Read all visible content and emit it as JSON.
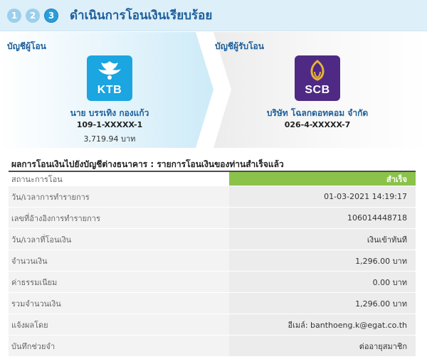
{
  "header": {
    "steps": [
      "1",
      "2",
      "3"
    ],
    "title": "ดำเนินการโอนเงินเรียบร้อย"
  },
  "from_account": {
    "section_label": "บัญชีผู้โอน",
    "bank_logo": "KTB",
    "name": "นาย บรรเทิง กองแก้ว",
    "account_no": "109-1-XXXXX-1",
    "balance": "3,719.94 บาท"
  },
  "to_account": {
    "section_label": "บัญชีผู้รับโอน",
    "bank_logo": "SCB",
    "name": "บริษัท โฉลกดอทคอม จำกัด",
    "account_no": "026-4-XXXXX-7"
  },
  "result": {
    "title": "ผลการโอนเงินไปยังบัญชีต่างธนาคาร : รายการโอนเงินของท่านสำเร็จแล้ว",
    "rows": [
      {
        "label": "สถานะการโอน",
        "value": "สำเร็จ"
      },
      {
        "label": "วัน/เวลาการทำรายการ",
        "value": "01-03-2021 14:19:17"
      },
      {
        "label": "เลขที่อ้างอิงการทำรายการ",
        "value": "106014448718"
      },
      {
        "label": "วัน/เวลาที่โอนเงิน",
        "value": "เงินเข้าทันที"
      },
      {
        "label": "จำนวนเงิน",
        "value": "1,296.00 บาท"
      },
      {
        "label": "ค่าธรรมเนียม",
        "value": "0.00 บาท"
      },
      {
        "label": "รวมจำนวนเงิน",
        "value": "1,296.00 บาท"
      },
      {
        "label": "แจ้งผลโดย",
        "value": "อีเมล์: banthoeng.k@egat.co.th"
      },
      {
        "label": "บันทึกช่วยจำ",
        "value": "ต่ออายุสมาชิก"
      }
    ]
  },
  "colors": {
    "header_bg": "#ddeff9",
    "title": "#1d5f9b",
    "ktb": "#1ba5e1",
    "scb": "#4e2a84",
    "success": "#8bc34a"
  }
}
